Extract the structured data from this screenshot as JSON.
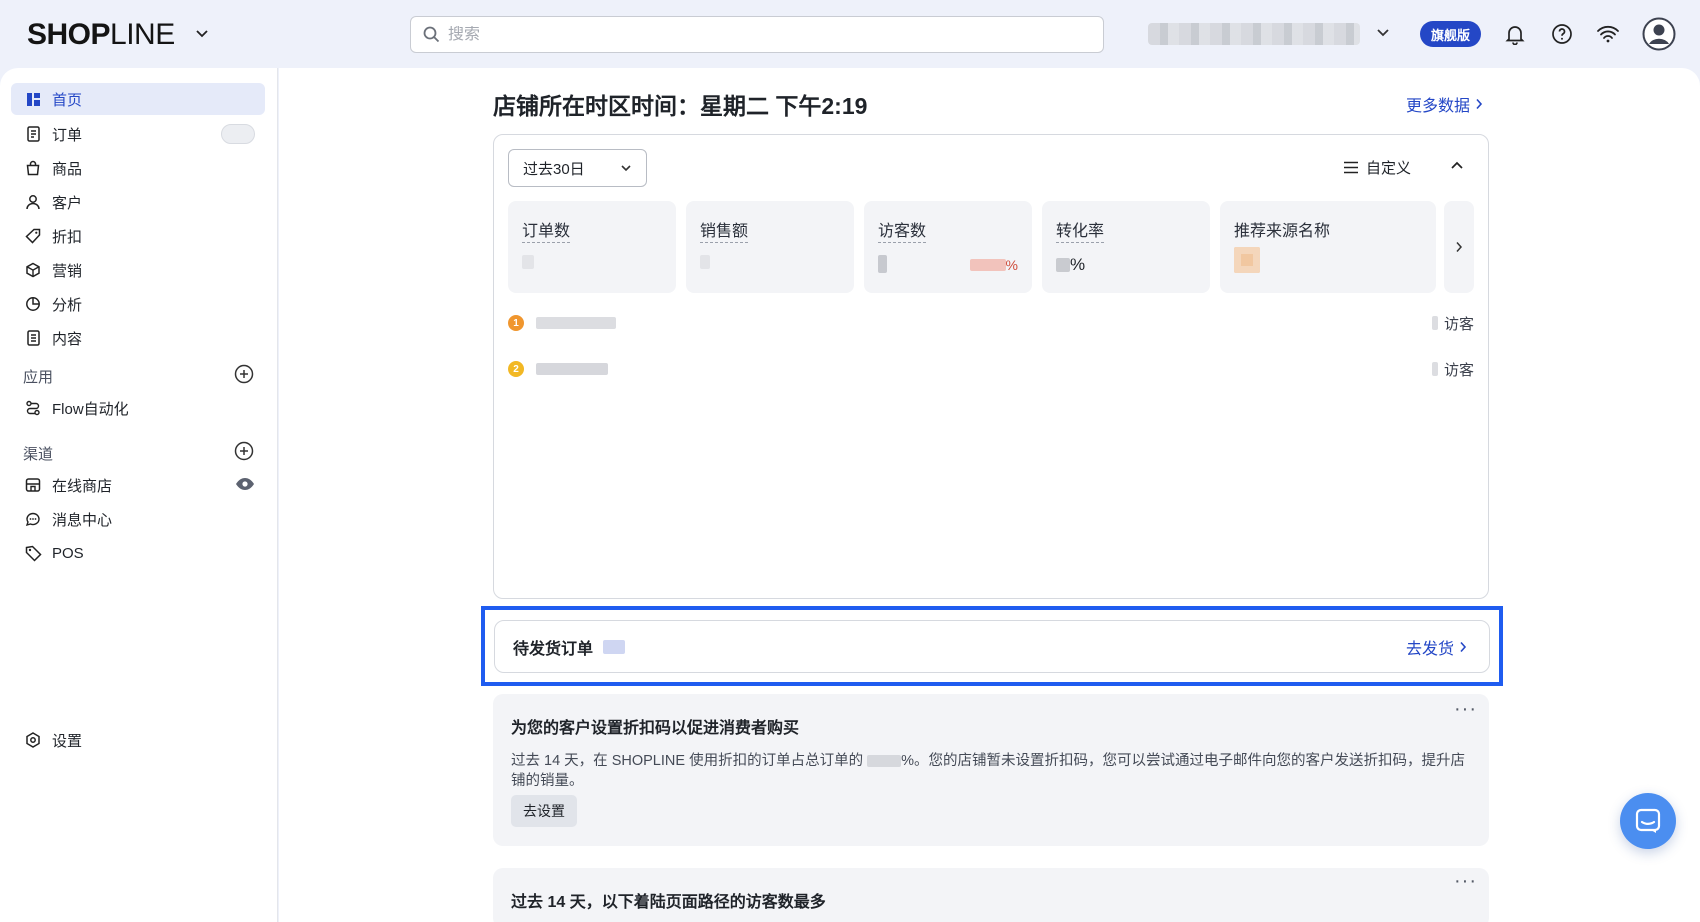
{
  "brand": {
    "logo_a": "SHOP",
    "logo_b": "LINE"
  },
  "header": {
    "search_placeholder": "搜索",
    "plan_badge": "旗舰版"
  },
  "sidebar": {
    "items": [
      {
        "label": "首页",
        "icon": "dashboard-icon",
        "active": true
      },
      {
        "label": "订单",
        "icon": "order-icon"
      },
      {
        "label": "商品",
        "icon": "bag-icon"
      },
      {
        "label": "客户",
        "icon": "user-icon"
      },
      {
        "label": "折扣",
        "icon": "tag-icon"
      },
      {
        "label": "营销",
        "icon": "cube-icon"
      },
      {
        "label": "分析",
        "icon": "chart-pie-icon"
      },
      {
        "label": "内容",
        "icon": "document-icon"
      }
    ],
    "apps_title": "应用",
    "apps": [
      {
        "label": "Flow自动化",
        "icon": "flow-icon"
      }
    ],
    "channels_title": "渠道",
    "channels": [
      {
        "label": "在线商店",
        "icon": "store-icon"
      },
      {
        "label": "消息中心",
        "icon": "chat-icon"
      },
      {
        "label": "POS",
        "icon": "pos-tag-icon"
      }
    ],
    "settings": {
      "label": "设置",
      "icon": "settings-icon"
    }
  },
  "main": {
    "title": "店铺所在时区时间：星期二 下午2:19",
    "more_data": "更多数据",
    "stats": {
      "range": "过去30日",
      "customize": "自定义",
      "metrics": [
        {
          "label": "订单数"
        },
        {
          "label": "销售额"
        },
        {
          "label": "访客数",
          "change_suffix": "%"
        },
        {
          "label": "转化率",
          "value_suffix": "%"
        },
        {
          "label": "推荐来源名称"
        }
      ],
      "referrers": [
        {
          "rank": "1",
          "unit": "访客",
          "color": "#f0962e"
        },
        {
          "rank": "2",
          "unit": "访客",
          "color": "#f2b824"
        }
      ]
    },
    "pending": {
      "title": "待发货订单",
      "action": "去发货"
    },
    "tip": {
      "title": "为您的客户设置折扣码以促进消费者购买",
      "body_a": "过去 14 天，在 SHOPLINE 使用折扣的订单占总订单的",
      "body_b": "%。您的店铺暂未设置折扣码，您可以尝试通过电子邮件向您的客户发送折扣码，提升店铺的销量。",
      "button": "去设置",
      "menu": "···"
    },
    "paths": {
      "title": "过去 14 天，以下着陆页面路径的访客数最多",
      "menu": "···"
    }
  },
  "colors": {
    "accent": "#2447c6",
    "highlight": "#1f5cf0",
    "fab": "#4b8ef0"
  }
}
